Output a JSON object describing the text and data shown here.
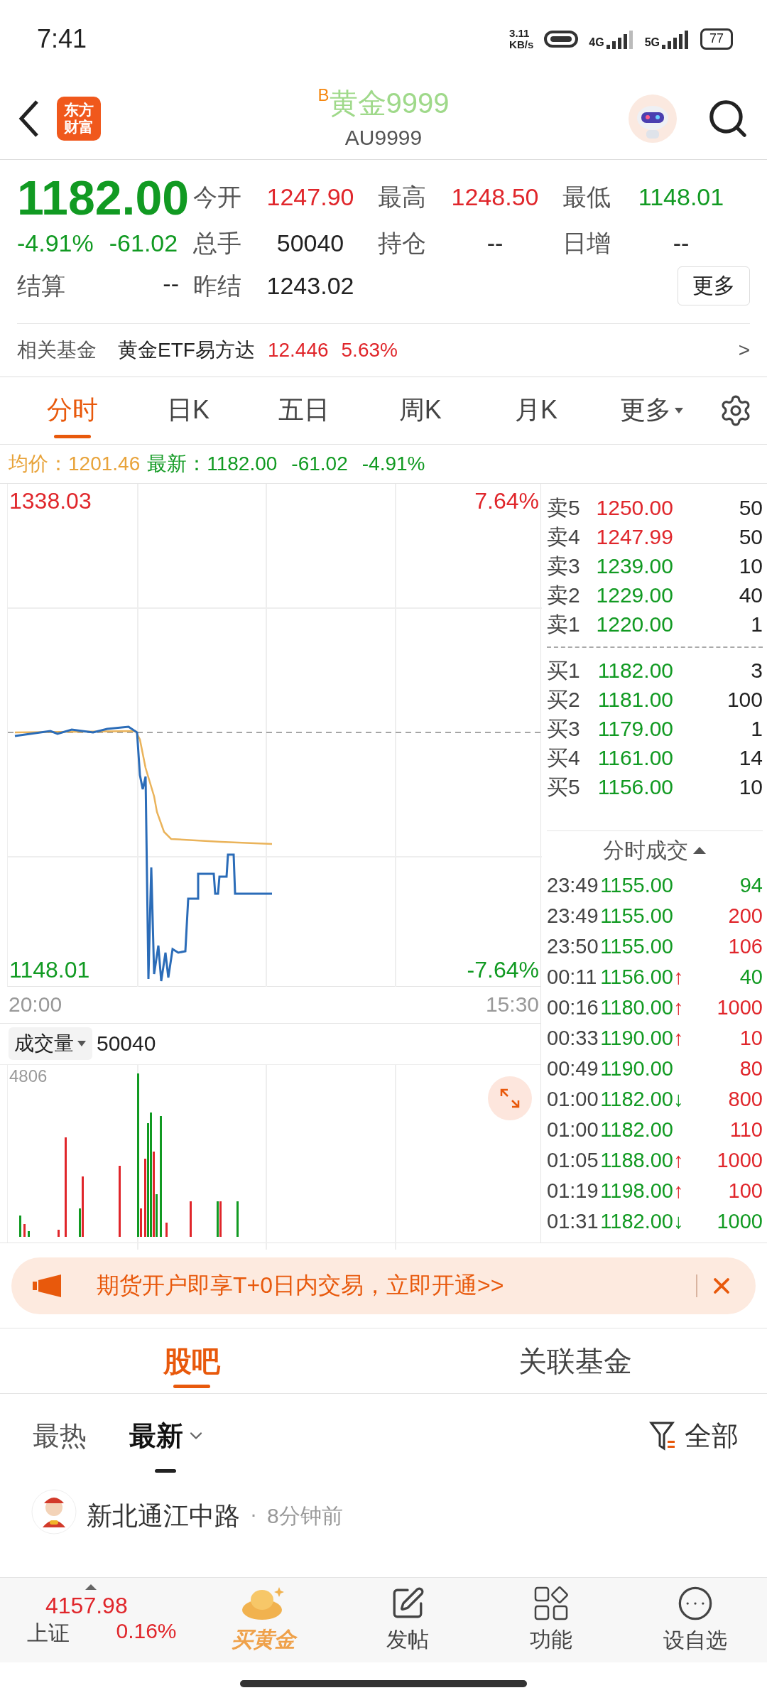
{
  "status_bar": {
    "time": "7:41",
    "speed_value": "3.11",
    "speed_unit": "KB/s",
    "network_1": "4G",
    "network_2": "5G",
    "battery": "77"
  },
  "header": {
    "logo_lines": [
      "东方",
      "财富"
    ],
    "badge": "B",
    "title": "黄金9999",
    "code": "AU9999"
  },
  "quote": {
    "price": "1182.00",
    "change_pct": "-4.91%",
    "change": "-61.02",
    "settle_label": "结算",
    "settle_value": "--",
    "more_button": "更多",
    "stats": [
      {
        "label": "今开",
        "value": "1247.90",
        "color": "#e0262b"
      },
      {
        "label": "最高",
        "value": "1248.50",
        "color": "#e0262b"
      },
      {
        "label": "最低",
        "value": "1148.01",
        "color": "#119a22"
      },
      {
        "label": "总手",
        "value": "50040",
        "color": "#222222"
      },
      {
        "label": "持仓",
        "value": "--",
        "color": "#222222"
      },
      {
        "label": "日增",
        "value": "--",
        "color": "#222222"
      },
      {
        "label": "昨结",
        "value": "1243.02",
        "color": "#222222"
      }
    ]
  },
  "related_fund": {
    "label": "相关基金",
    "name": "黄金ETF易方达",
    "price": "12.446",
    "change": "5.63%",
    "arrow": ">"
  },
  "tabs": [
    {
      "label": "分时",
      "selected": true,
      "kind": "tab"
    },
    {
      "label": "日K",
      "selected": false,
      "kind": "tab"
    },
    {
      "label": "五日",
      "selected": false,
      "kind": "tab"
    },
    {
      "label": "周K",
      "selected": false,
      "kind": "tab"
    },
    {
      "label": "月K",
      "selected": false,
      "kind": "tab"
    },
    {
      "label": "更多",
      "selected": false,
      "kind": "menu"
    }
  ],
  "summary": {
    "avg_label": "均价：",
    "avg_value": "1201.46",
    "latest_label": "最新：",
    "latest_value": "1182.00",
    "change": "-61.02",
    "change_pct": "-4.91%"
  },
  "chart": {
    "high": "1338.03",
    "high_pct": "7.64%",
    "low": "1148.01",
    "low_pct": "-7.64%",
    "start_time": "20:00",
    "end_time": "15:30"
  },
  "volume": {
    "selector": "成交量",
    "value": "50040",
    "max": "4806"
  },
  "order_book": {
    "asks": [
      {
        "label": "卖5",
        "price": "1250.00",
        "volume": "50",
        "color": "#e0262b"
      },
      {
        "label": "卖4",
        "price": "1247.99",
        "volume": "50",
        "color": "#e0262b"
      },
      {
        "label": "卖3",
        "price": "1239.00",
        "volume": "10",
        "color": "#119a22"
      },
      {
        "label": "卖2",
        "price": "1229.00",
        "volume": "40",
        "color": "#119a22"
      },
      {
        "label": "卖1",
        "price": "1220.00",
        "volume": "1",
        "color": "#119a22"
      }
    ],
    "bids": [
      {
        "label": "买1",
        "price": "1182.00",
        "volume": "3",
        "color": "#119a22"
      },
      {
        "label": "买2",
        "price": "1181.00",
        "volume": "100",
        "color": "#119a22"
      },
      {
        "label": "买3",
        "price": "1179.00",
        "volume": "1",
        "color": "#119a22"
      },
      {
        "label": "买4",
        "price": "1161.00",
        "volume": "14",
        "color": "#119a22"
      },
      {
        "label": "买5",
        "price": "1156.00",
        "volume": "10",
        "color": "#119a22"
      }
    ]
  },
  "trades": {
    "title": "分时成交",
    "rows": [
      {
        "time": "23:49",
        "price": "1155.00",
        "volume": "94",
        "color": "#119a22"
      },
      {
        "time": "23:49",
        "price": "1155.00",
        "volume": "200",
        "color": "#e0262b"
      },
      {
        "time": "23:50",
        "price": "1155.00",
        "volume": "106",
        "color": "#e0262b"
      },
      {
        "time": "00:11",
        "price": "1156.00",
        "arrow": {
          "text": "↑",
          "color": "#e0262b"
        },
        "volume": "40",
        "color": "#119a22"
      },
      {
        "time": "00:16",
        "price": "1180.00",
        "arrow": {
          "text": "↑",
          "color": "#e0262b"
        },
        "volume": "1000",
        "color": "#e0262b"
      },
      {
        "time": "00:33",
        "price": "1190.00",
        "arrow": {
          "text": "↑",
          "color": "#e0262b"
        },
        "volume": "10",
        "color": "#e0262b"
      },
      {
        "time": "00:49",
        "price": "1190.00",
        "volume": "80",
        "color": "#e0262b"
      },
      {
        "time": "01:00",
        "price": "1182.00",
        "arrow": {
          "text": "↓",
          "color": "#119a22"
        },
        "volume": "800",
        "color": "#e0262b"
      },
      {
        "time": "01:00",
        "price": "1182.00",
        "volume": "110",
        "color": "#e0262b"
      },
      {
        "time": "01:05",
        "price": "1188.00",
        "arrow": {
          "text": "↑",
          "color": "#e0262b"
        },
        "volume": "1000",
        "color": "#e0262b"
      },
      {
        "time": "01:19",
        "price": "1198.00",
        "arrow": {
          "text": "↑",
          "color": "#e0262b"
        },
        "volume": "100",
        "color": "#e0262b"
      },
      {
        "time": "01:31",
        "price": "1182.00",
        "arrow": {
          "text": "↓",
          "color": "#119a22"
        },
        "volume": "1000",
        "color": "#119a22"
      }
    ]
  },
  "banner": {
    "text": "期货开户即享T+0日内交易，立即开通>>"
  },
  "community_tabs": [
    {
      "label": "股吧",
      "selected": true
    },
    {
      "label": "关联基金",
      "selected": false
    }
  ],
  "sort": [
    {
      "label": "最热",
      "selected": false
    },
    {
      "label": "最新",
      "selected": true
    }
  ],
  "filter": "全部",
  "post": {
    "author": "新北通江中路",
    "separator": "·",
    "time": "8分钟前"
  },
  "bottom_nav": {
    "index": {
      "value": "4157.98",
      "name": "上证",
      "change": "0.16%"
    },
    "items": [
      {
        "label": "买黄金",
        "kind": "gold"
      },
      {
        "label": "发帖",
        "kind": "edit"
      },
      {
        "label": "功能",
        "kind": "apps"
      },
      {
        "label": "设自选",
        "kind": "more"
      }
    ]
  }
}
